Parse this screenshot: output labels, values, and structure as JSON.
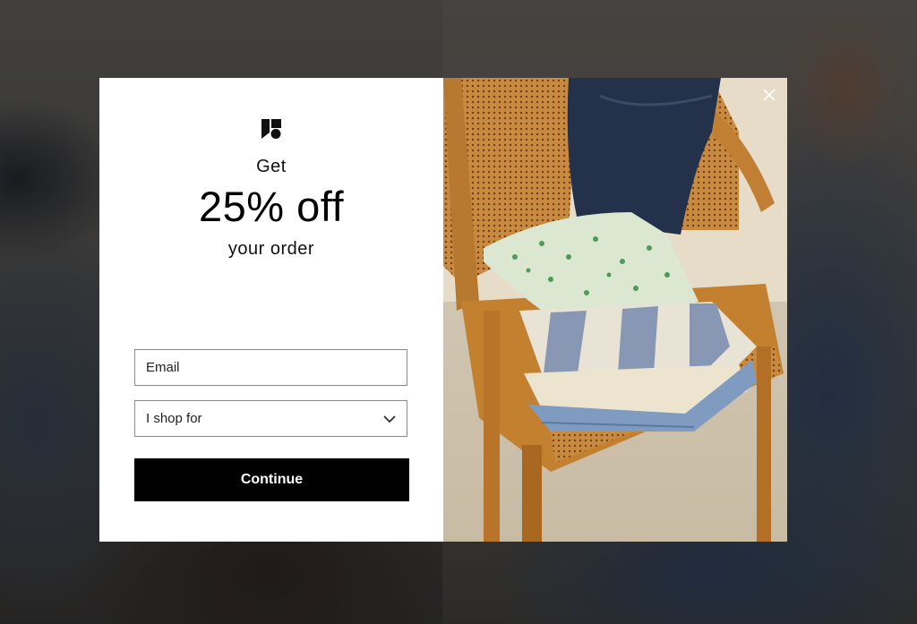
{
  "modal": {
    "headline_top": "Get",
    "headline_main": "25% off",
    "headline_bottom": "your order",
    "email_placeholder": "Email",
    "shop_for_selected": "I shop for",
    "continue_label": "Continue"
  },
  "icons": {
    "logo": "brand-logo-icon",
    "close": "close-icon",
    "dropdown": "chevron-down-icon"
  },
  "colors": {
    "button_bg": "#000000",
    "button_text": "#ffffff",
    "overlay": "#3b3a39"
  }
}
